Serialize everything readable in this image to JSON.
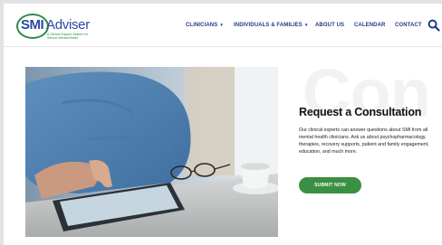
{
  "logo": {
    "brand_prefix": "SMI",
    "brand_suffix": "Adviser",
    "tagline_line1": "A Clinical Support System for",
    "tagline_line2": "Serious Mental Illness"
  },
  "nav": {
    "clinicians": "CLINICIANS",
    "individuals": "INDIVIDUALS & FAMILIES",
    "about": "ABOUT US",
    "calendar": "CALENDAR",
    "contact": "CONTACT",
    "caret": "▾"
  },
  "hero": {
    "bg_word": "Con",
    "title": "Request a Consultation",
    "description": "Our clinical experts can answer questions about SMI from all mental health clinicians. Ask us about psychopharmacology, therapies, recovery supports, patient and family engagement, education, and much more.",
    "button": "SUBMIT NOW"
  },
  "colors": {
    "nav_text": "#1f3d84",
    "brand_blue": "#2b4a9b",
    "brand_green": "#2e8a4a",
    "button_green": "#3a8f43"
  },
  "icons": {
    "search": "search-icon",
    "caret": "chevron-down-icon"
  }
}
